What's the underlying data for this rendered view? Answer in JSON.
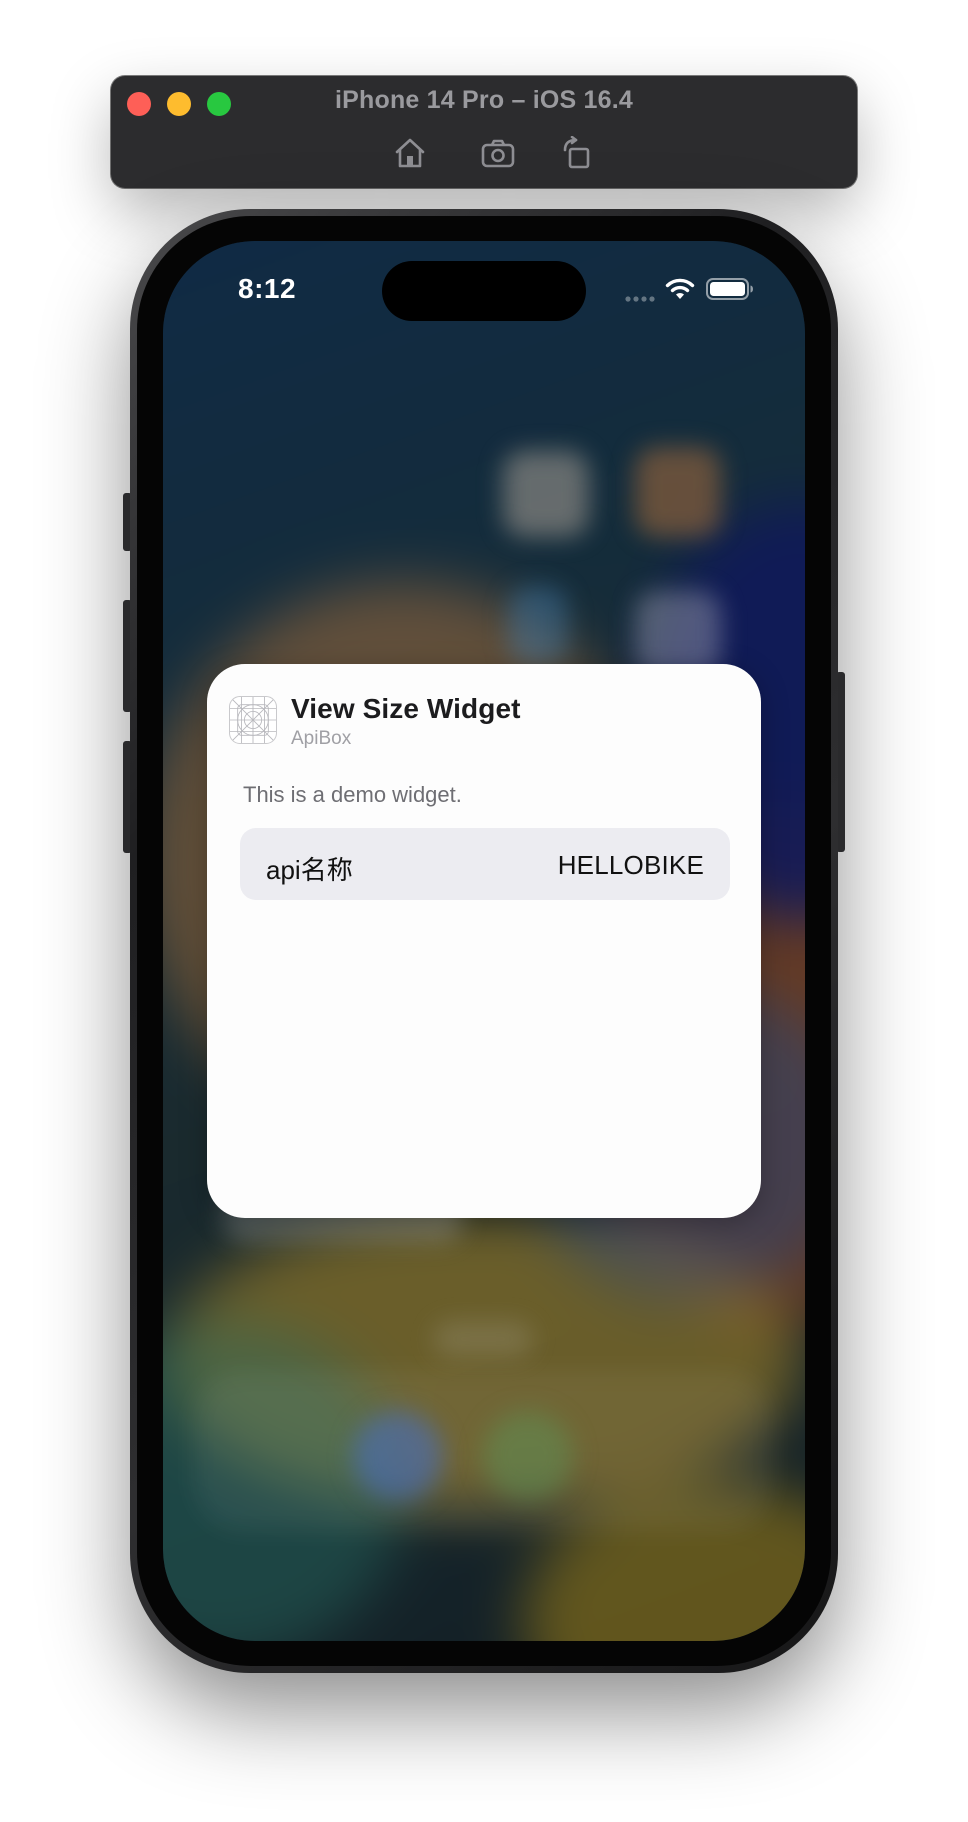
{
  "simulator": {
    "window_title": "iPhone 14 Pro – iOS 16.4",
    "toolbar_icons": [
      "home-icon",
      "screenshot-icon",
      "rotate-icon"
    ],
    "traffic_light_colors": {
      "close": "#fe5f57",
      "minimize": "#febc2e",
      "zoom": "#28c840"
    }
  },
  "status_bar": {
    "time": "8:12",
    "icons": [
      "cellular-signal-icon",
      "wifi-icon",
      "battery-icon"
    ]
  },
  "widget": {
    "title": "View Size Widget",
    "app_name": "ApiBox",
    "description": "This is a demo widget.",
    "row": {
      "key": "api名称",
      "value": "HELLOBIKE"
    }
  },
  "colors": {
    "card_background": "#fdfdfd",
    "row_background": "#ececf1",
    "title_text": "#1c1c1e",
    "secondary_text": "#6e6e73"
  }
}
